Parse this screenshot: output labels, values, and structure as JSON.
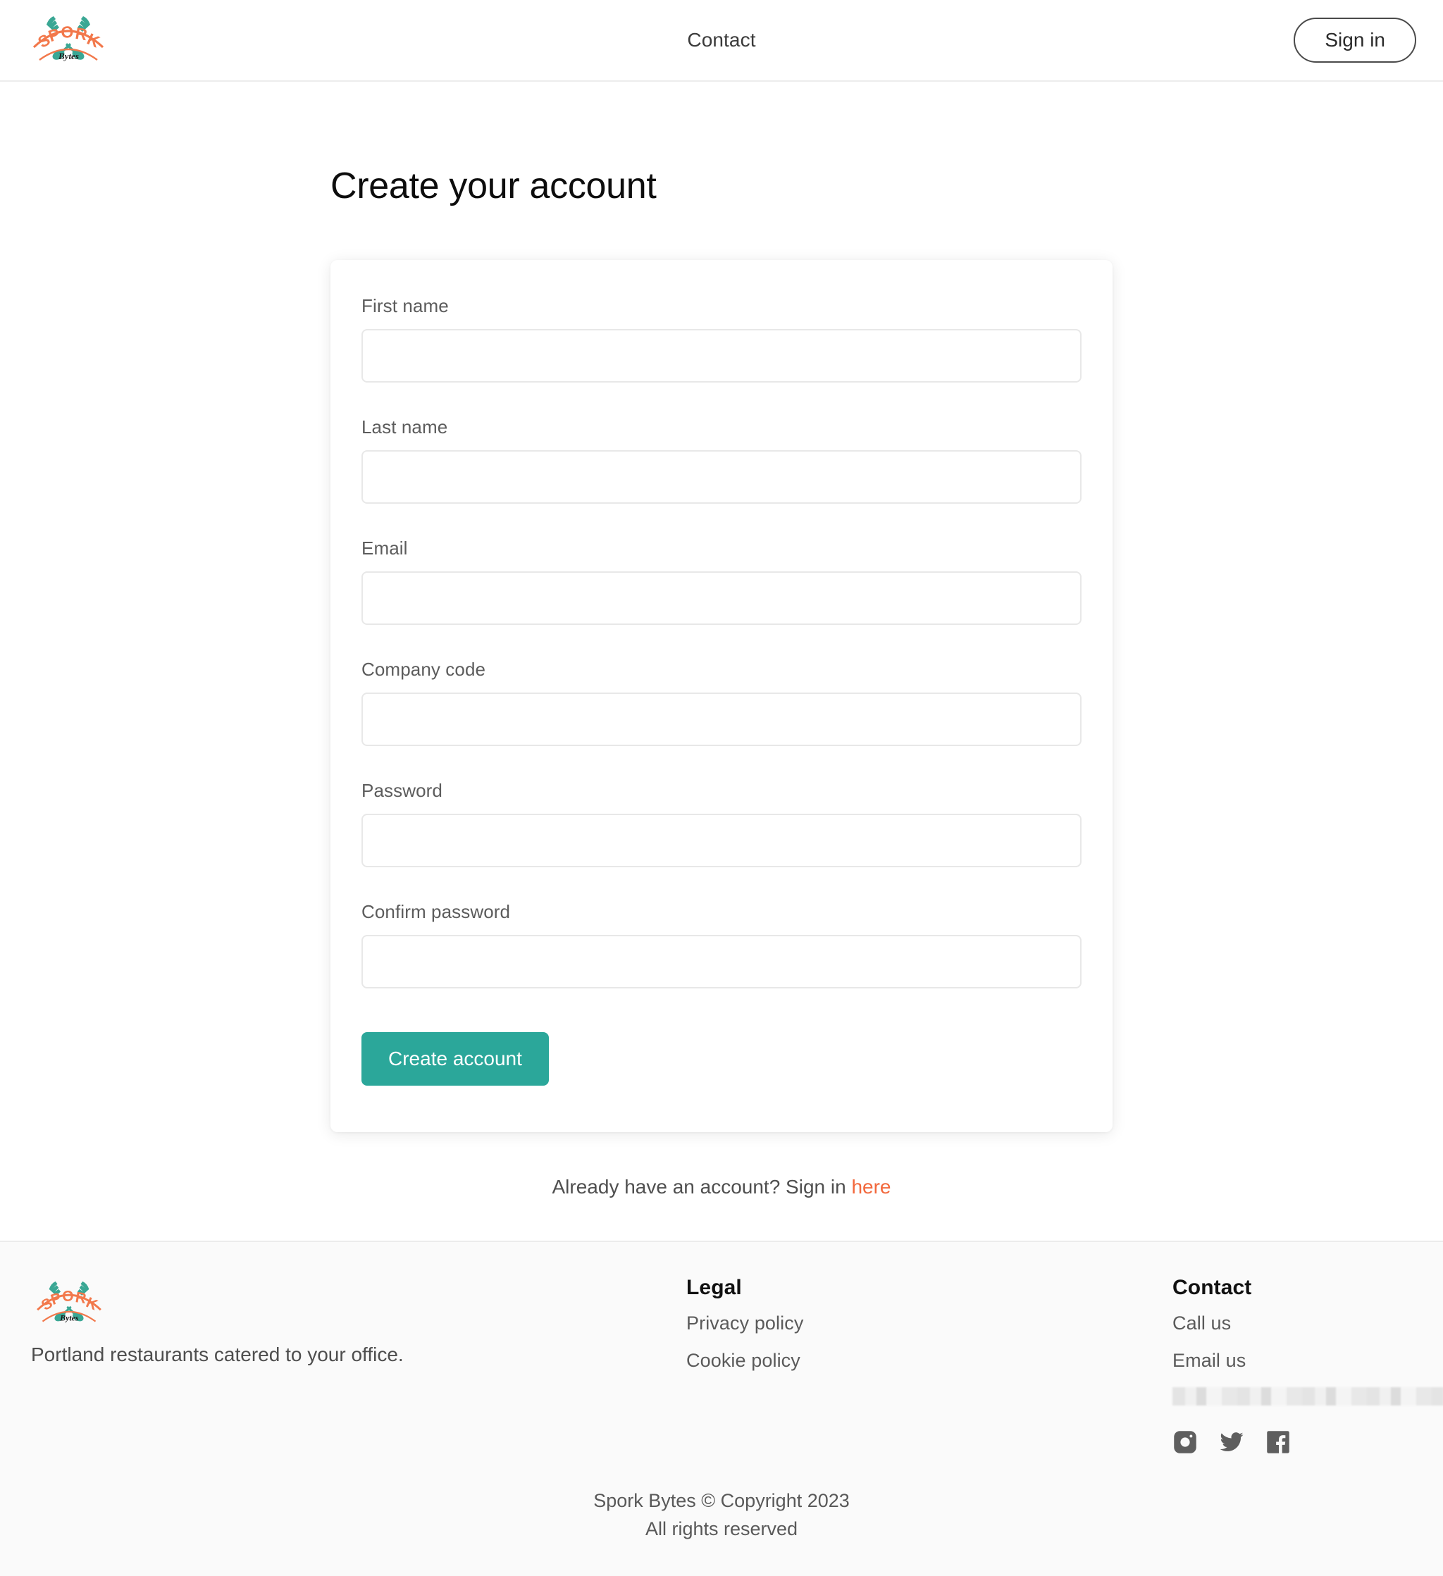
{
  "header": {
    "logo_alt": "Spork Bytes",
    "nav": [
      {
        "label": "Contact"
      }
    ],
    "signin_label": "Sign in"
  },
  "main": {
    "title": "Create your account",
    "form": {
      "fields": [
        {
          "label": "First name",
          "value": "",
          "placeholder": "",
          "type": "text"
        },
        {
          "label": "Last name",
          "value": "",
          "placeholder": "",
          "type": "text"
        },
        {
          "label": "Email",
          "value": "",
          "placeholder": "",
          "type": "email"
        },
        {
          "label": "Company code",
          "value": "",
          "placeholder": "",
          "type": "text"
        },
        {
          "label": "Password",
          "value": "",
          "placeholder": "",
          "type": "password"
        },
        {
          "label": "Confirm password",
          "value": "",
          "placeholder": "",
          "type": "password"
        }
      ],
      "submit_label": "Create account"
    },
    "alt_action": {
      "text": "Already have an account? Sign in ",
      "link_label": "here"
    }
  },
  "footer": {
    "logo_alt": "Spork Bytes",
    "tagline": "Portland restaurants catered to your office.",
    "legal": {
      "heading": "Legal",
      "links": [
        {
          "label": "Privacy policy"
        },
        {
          "label": "Cookie policy"
        }
      ]
    },
    "contact": {
      "heading": "Contact",
      "links": [
        {
          "label": "Call us"
        },
        {
          "label": "Email us"
        }
      ],
      "address_redacted": "",
      "socials": [
        {
          "name": "instagram-icon"
        },
        {
          "name": "twitter-icon"
        },
        {
          "name": "facebook-icon"
        }
      ]
    },
    "copyright_line1": "Spork Bytes © Copyright 2023",
    "copyright_line2": "All rights reserved"
  },
  "colors": {
    "accent_teal": "#2ba79a",
    "accent_orange": "#f2683c",
    "logo_orange": "#f2784b",
    "logo_teal": "#3aa794",
    "footer_bg": "#fafafa",
    "border": "#ececec"
  }
}
